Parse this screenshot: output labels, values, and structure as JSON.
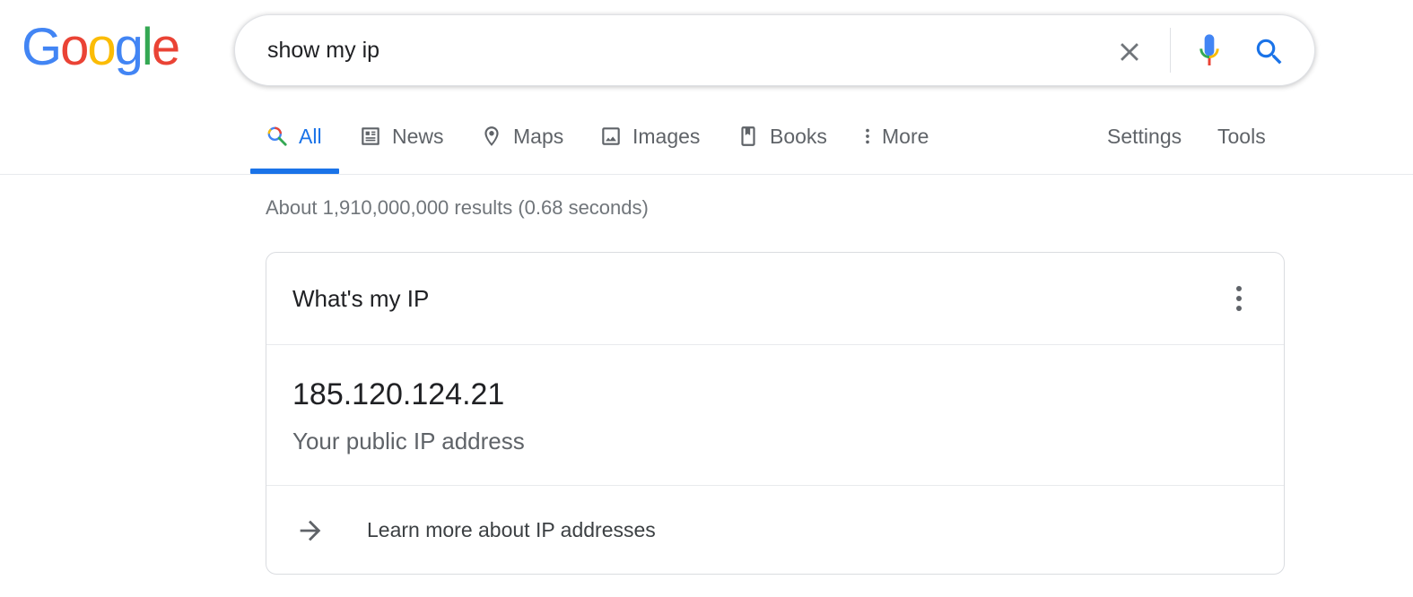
{
  "logo": {
    "letters": [
      "G",
      "o",
      "o",
      "g",
      "l",
      "e"
    ],
    "colors": [
      "#4285F4",
      "#EA4335",
      "#FBBC05",
      "#4285F4",
      "#34A853",
      "#EA4335"
    ]
  },
  "search": {
    "query": "show my ip"
  },
  "tabs": [
    {
      "label": "All",
      "icon": "search-icon",
      "active": true
    },
    {
      "label": "News",
      "icon": "news-icon"
    },
    {
      "label": "Maps",
      "icon": "map-pin-icon"
    },
    {
      "label": "Images",
      "icon": "image-icon"
    },
    {
      "label": "Books",
      "icon": "book-icon"
    },
    {
      "label": "More",
      "icon": "more-vert-icon"
    }
  ],
  "tools": {
    "settings": "Settings",
    "tools": "Tools"
  },
  "results_stats": "About 1,910,000,000 results (0.68 seconds)",
  "card": {
    "title": "What's my IP",
    "ip": "185.120.124.21",
    "caption": "Your public IP address",
    "learn_more": "Learn more about IP addresses"
  },
  "colors": {
    "accent": "#1a73e8",
    "text": "#202124",
    "muted": "#5f6368",
    "border": "#dadce0"
  }
}
